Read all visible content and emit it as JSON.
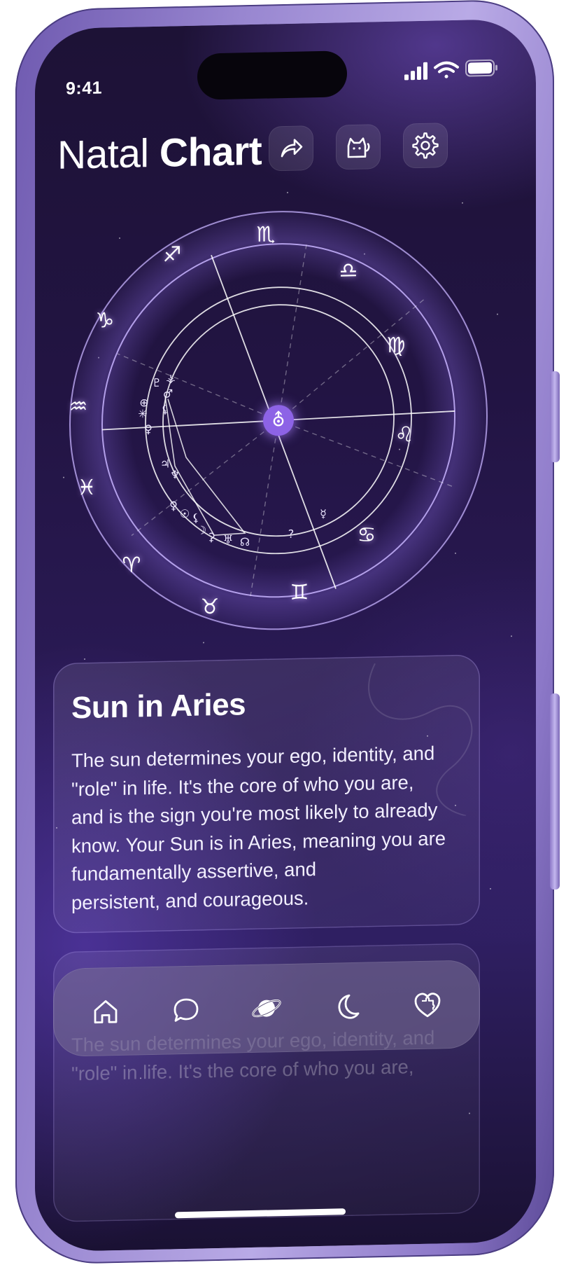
{
  "status_bar": {
    "time": "9:41",
    "icons": [
      "signal-icon",
      "wifi-icon",
      "battery-icon"
    ]
  },
  "header": {
    "title_light": "Natal",
    "title_bold": "Chart",
    "buttons": [
      {
        "name": "share-button",
        "icon": "share-arrow-icon"
      },
      {
        "name": "pet-button",
        "icon": "cat-icon"
      },
      {
        "name": "settings-button",
        "icon": "gear-icon"
      }
    ]
  },
  "chart": {
    "center_symbol": "⛢",
    "zodiac_signs": [
      {
        "name": "scorpio",
        "symbol": "♏"
      },
      {
        "name": "libra",
        "symbol": "♎"
      },
      {
        "name": "virgo",
        "symbol": "♍"
      },
      {
        "name": "leo",
        "symbol": "♌"
      },
      {
        "name": "cancer",
        "symbol": "♋"
      },
      {
        "name": "gemini",
        "symbol": "♊"
      },
      {
        "name": "taurus",
        "symbol": "♉"
      },
      {
        "name": "aries",
        "symbol": "♈"
      },
      {
        "name": "pisces",
        "symbol": "♓"
      },
      {
        "name": "aquarius",
        "symbol": "♒"
      },
      {
        "name": "capricorn",
        "symbol": "♑"
      },
      {
        "name": "sagittarius",
        "symbol": "♐"
      }
    ],
    "planet_glyphs": [
      {
        "name": "pluto",
        "symbol": "♇"
      },
      {
        "name": "vesta",
        "symbol": "⚶"
      },
      {
        "name": "earth",
        "symbol": "⊕"
      },
      {
        "name": "mars",
        "symbol": "♂"
      },
      {
        "name": "uranus-star",
        "symbol": "✳"
      },
      {
        "name": "serpent",
        "symbol": "⚸"
      },
      {
        "name": "venus",
        "symbol": "♀"
      },
      {
        "name": "jupiter",
        "symbol": "♃"
      },
      {
        "name": "neptune",
        "symbol": "♆"
      },
      {
        "name": "venus-2",
        "symbol": "♀"
      },
      {
        "name": "sun",
        "symbol": "☉"
      },
      {
        "name": "lilith",
        "symbol": "⚸"
      },
      {
        "name": "moon",
        "symbol": "☽"
      },
      {
        "name": "ceres",
        "symbol": "⚳"
      },
      {
        "name": "uranus",
        "symbol": "♅"
      },
      {
        "name": "node",
        "symbol": "☊"
      },
      {
        "name": "unknown",
        "symbol": "?"
      },
      {
        "name": "mercury",
        "symbol": "☿"
      }
    ]
  },
  "card": {
    "title": "Sun in Aries",
    "body": "The sun determines your ego, identity, and\n\"role\" in life. It's the core of who you are,\nand is the sign you're most likely to already\nknow. Your Sun is in Aries, meaning you are\nfundamentally  assertive, and\npersistent, and courageous."
  },
  "card_secondary": {
    "body": "The sun determines your ego, identity, and\n\"role\" in life. It's the core of who you are,"
  },
  "tab_bar": {
    "tabs": [
      {
        "name": "tab-home",
        "icon": "home-icon"
      },
      {
        "name": "tab-chat",
        "icon": "chat-bubble-icon"
      },
      {
        "name": "tab-planet",
        "icon": "planet-icon",
        "active": true
      },
      {
        "name": "tab-moon",
        "icon": "moon-icon"
      },
      {
        "name": "tab-heart",
        "icon": "heart-puzzle-icon"
      }
    ]
  },
  "colors": {
    "accent": "#8d63e6",
    "frame": "#9886d0",
    "background": "#221443"
  }
}
